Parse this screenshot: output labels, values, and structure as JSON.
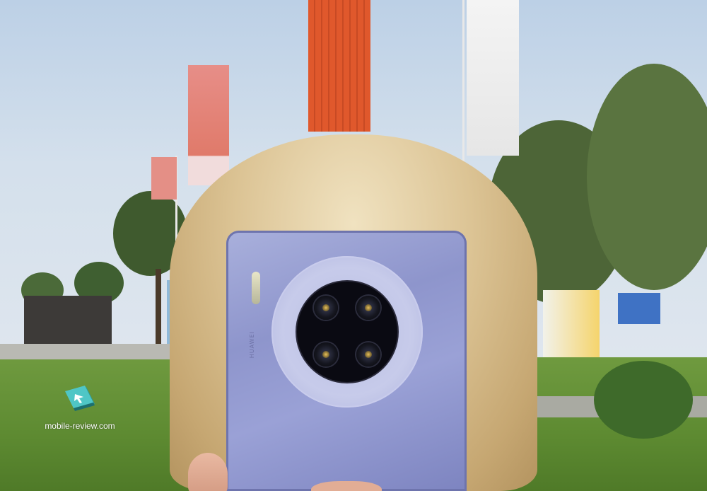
{
  "watermark": {
    "text": "mobile-review.com",
    "icon": "mobile-review-logo-icon"
  },
  "phone": {
    "brand_text": "HUAWEI",
    "color": "#9aa1d6"
  },
  "colors": {
    "sky": "#d4e0ec",
    "grass": "#5d8a31",
    "hair": "#dcc495",
    "banner_red": "#e07a6a",
    "banner_orange": "#e0582c",
    "logo_teal": "#4fc6c6"
  }
}
